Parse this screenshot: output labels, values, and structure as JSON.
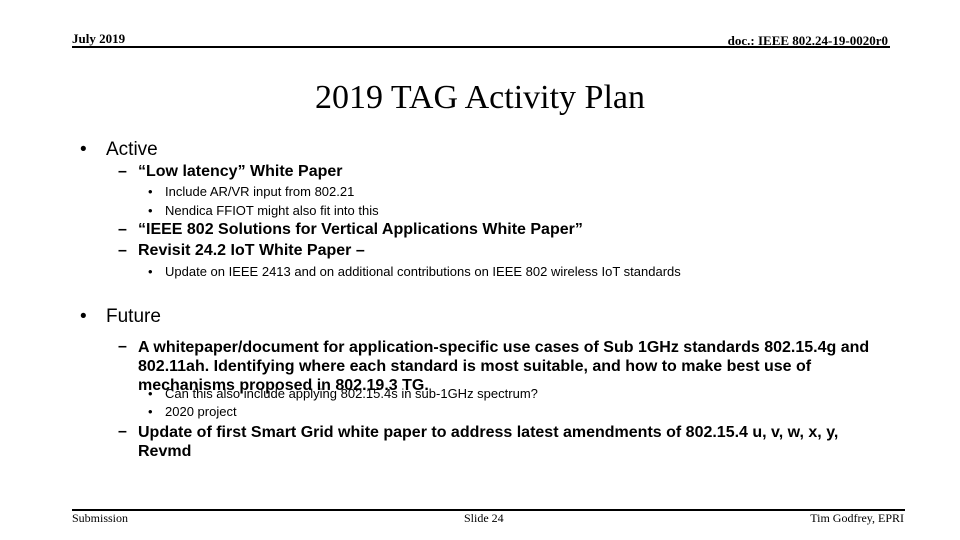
{
  "header": {
    "date": "July 2019",
    "doc_id": "doc.: IEEE 802.24-19-0020r0"
  },
  "title": "2019 TAG Activity Plan",
  "sections": [
    {
      "label": "Active",
      "items": [
        {
          "text": "“Low latency” White Paper",
          "subitems": [
            "Include AR/VR input from 802.21",
            "Nendica FFIOT might also fit into this"
          ]
        },
        {
          "text": "“IEEE 802 Solutions for Vertical Applications White Paper”",
          "subitems": []
        },
        {
          "text": "Revisit 24.2 IoT White Paper –",
          "subitems": [
            "Update on IEEE 2413 and on additional contributions on IEEE 802 wireless IoT standards"
          ]
        }
      ]
    },
    {
      "label": "Future",
      "items": [
        {
          "text": "A whitepaper/document for application-specific use cases of Sub 1GHz standards 802.15.4g and 802.11ah. Identifying where each standard is most suitable, and how to make best use of mechanisms proposed in 802.19.3 TG.",
          "subitems": [
            "Can this also include applying 802.15.4s in sub-1GHz spectrum?",
            "2020 project"
          ]
        },
        {
          "text": "Update of first Smart Grid white paper to address latest amendments of 802.15.4 u, v, w, x, y, Revmd",
          "subitems": []
        }
      ]
    }
  ],
  "bullets": {
    "level1": "•",
    "level2": "–",
    "level3": "•"
  },
  "footer": {
    "left": "Submission",
    "center": "Slide 24",
    "right": "Tim Godfrey, EPRI"
  }
}
